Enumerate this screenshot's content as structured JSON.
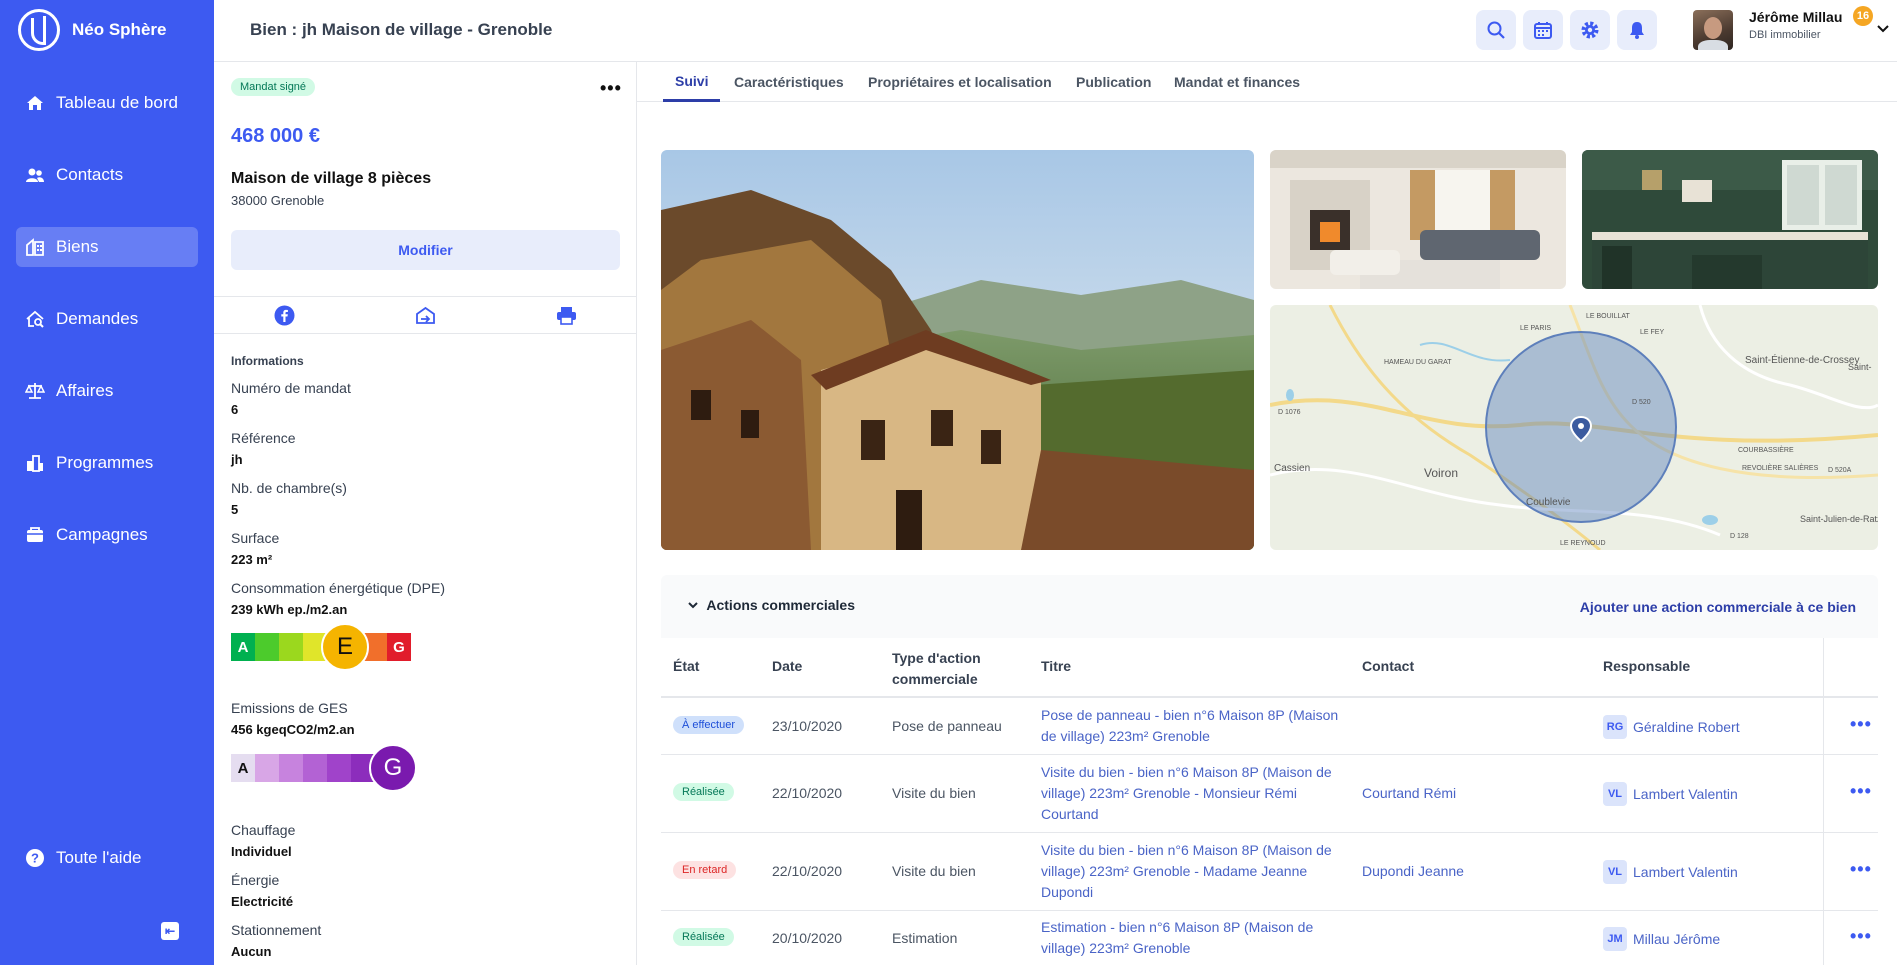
{
  "app": {
    "name": "Néo Sphère"
  },
  "sidebar": {
    "items": [
      {
        "label": "Tableau de bord",
        "icon": "home-icon"
      },
      {
        "label": "Contacts",
        "icon": "users-icon"
      },
      {
        "label": "Biens",
        "icon": "building-icon",
        "active": true
      },
      {
        "label": "Demandes",
        "icon": "house-search-icon"
      },
      {
        "label": "Affaires",
        "icon": "scale-icon"
      },
      {
        "label": "Programmes",
        "icon": "city-icon"
      },
      {
        "label": "Campagnes",
        "icon": "campaign-icon"
      }
    ],
    "help_label": "Toute l'aide"
  },
  "header": {
    "title": "Bien : jh Maison de village - Grenoble",
    "notifications_count": "16",
    "user": {
      "name": "Jérôme Millau",
      "company": "DBI immobilier"
    }
  },
  "property": {
    "status": "Mandat signé",
    "price": "468 000 €",
    "title": "Maison de village 8 pièces",
    "city": "38000 Grenoble",
    "modify_label": "Modifier",
    "info_heading": "Informations",
    "fields": [
      {
        "label": "Numéro de mandat",
        "value": "6"
      },
      {
        "label": "Référence",
        "value": "jh"
      },
      {
        "label": "Nb. de chambre(s)",
        "value": "5"
      },
      {
        "label": "Surface",
        "value": "223 m²"
      },
      {
        "label": "Consommation énergétique (DPE)",
        "value": "239 kWh ep./m2.an"
      }
    ],
    "dpe": {
      "first": "A",
      "rating": "E",
      "last": "G"
    },
    "ges_label": "Emissions de GES",
    "ges_value": "456 kgeqCO2/m2.an",
    "ges": {
      "first": "A",
      "rating": "G"
    },
    "fields2": [
      {
        "label": "Chauffage",
        "value": "Individuel"
      },
      {
        "label": "Énergie",
        "value": "Electricité"
      },
      {
        "label": "Stationnement",
        "value": "Aucun"
      }
    ]
  },
  "tabs": [
    {
      "label": "Suivi",
      "active": true
    },
    {
      "label": "Caractéristiques"
    },
    {
      "label": "Propriétaires et localisation"
    },
    {
      "label": "Publication"
    },
    {
      "label": "Mandat et finances"
    }
  ],
  "map": {
    "labels": [
      "Saint-Étienne-de-Crossey",
      "Voiron",
      "Cassien",
      "Coublevie",
      "Saint-Julien-de-Ratz",
      "LE BOUILLAT",
      "LE PARIS",
      "LE FEY",
      "HAMEAU DU GARAT",
      "COURBASSIÈRE",
      "REVOLIÈRE SALIÈRES",
      "LE REYNOUD",
      "D 1076",
      "D 520",
      "D 520A",
      "D 128",
      "Saint-"
    ]
  },
  "actions": {
    "title": "Actions commerciales",
    "add_link": "Ajouter une action commerciale à ce bien",
    "columns": [
      "État",
      "Date",
      "Type d'action commerciale",
      "Titre",
      "Contact",
      "Responsable"
    ],
    "rows": [
      {
        "status": "À effectuer",
        "status_type": "blue",
        "date": "23/10/2020",
        "type": "Pose de panneau",
        "title": "Pose de panneau - bien n°6 Maison 8P (Maison de village) 223m² Grenoble",
        "contact": "",
        "resp_initials": "RG",
        "resp_name": "Géraldine Robert"
      },
      {
        "status": "Réalisée",
        "status_type": "green",
        "date": "22/10/2020",
        "type": "Visite du bien",
        "title": "Visite du bien - bien n°6 Maison 8P (Maison de village) 223m² Grenoble - Monsieur Rémi Courtand",
        "contact": "Courtand Rémi",
        "resp_initials": "VL",
        "resp_name": "Lambert Valentin"
      },
      {
        "status": "En retard",
        "status_type": "red",
        "date": "22/10/2020",
        "type": "Visite du bien",
        "title": "Visite du bien - bien n°6 Maison 8P (Maison de village) 223m² Grenoble - Madame Jeanne Dupondi",
        "contact": "Dupondi Jeanne",
        "resp_initials": "VL",
        "resp_name": "Lambert Valentin"
      },
      {
        "status": "Réalisée",
        "status_type": "green",
        "date": "20/10/2020",
        "type": "Estimation",
        "title": "Estimation - bien n°6 Maison 8P (Maison de village) 223m² Grenoble",
        "contact": "",
        "resp_initials": "JM",
        "resp_name": "Millau Jérôme"
      }
    ]
  },
  "colors": {
    "brand": "#3d5af1",
    "accent": "#2d3ea8"
  }
}
